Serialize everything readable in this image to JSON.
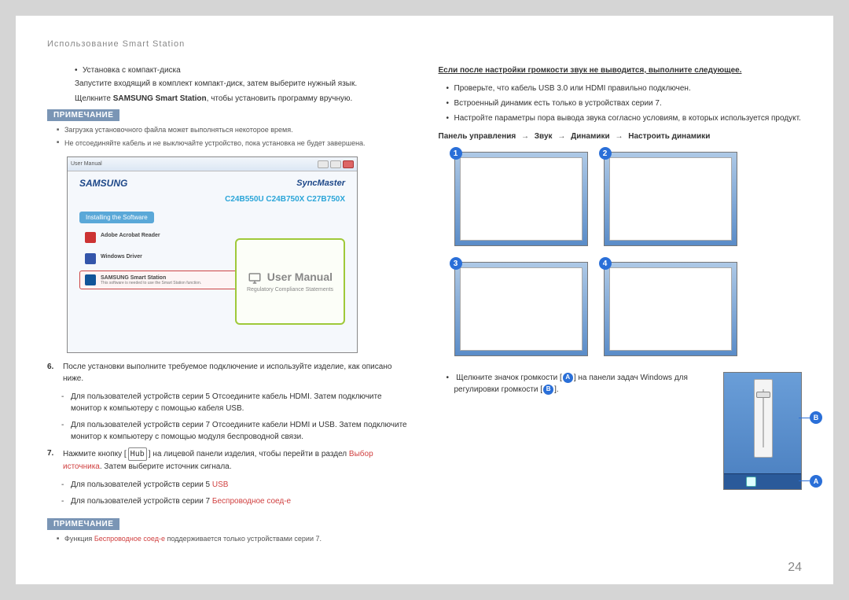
{
  "header": "Использование Smart Station",
  "page_number": "24",
  "left": {
    "install_cd": "Установка с компакт-диска",
    "install_cd_text": "Запустите входящий в комплект компакт-диск, затем выберите нужный язык.",
    "click_line_pre": "Щелкните ",
    "click_bold": "SAMSUNG Smart Station",
    "click_line_post": ", чтобы установить программу вручную.",
    "note_label": "ПРИМЕЧАНИЕ",
    "note1": "Загрузка установочного файла может выполняться некоторое время.",
    "note2": "Не отсоединяйте кабель и не выключайте устройство, пока установка не будет завершена.",
    "screenshot": {
      "titlebar": "User Manual",
      "samsung": "SAMSUNG",
      "syncmaster": "SyncMaster",
      "models": "C24B550U C24B750X C27B750X",
      "installing_bar": "Installing the Software",
      "item1_title": "Adobe Acrobat Reader",
      "item2_title": "Windows Driver",
      "item3_title": "SAMSUNG Smart Station",
      "item3_sub": "This software is needed to use the Smart Station function.",
      "um_text": "User Manual",
      "um_sub": "Regulatory Compliance Statements"
    },
    "step6_num": "6.",
    "step6": "После установки выполните требуемое подключение и используйте изделие, как описано ниже.",
    "step6_a": "Для пользователей устройств серии 5 Отсоедините кабель HDMI. Затем подключите монитор к компьютеру с помощью кабеля USB.",
    "step6_b": "Для пользователей устройств серии 7 Отсоедините кабели HDMI и USB. Затем подключите монитор к компьютеру с помощью модуля беспроводной связи.",
    "step7_num": "7.",
    "step7_pre": "Нажмите кнопку [",
    "step7_hub": "Hub",
    "step7_mid": "] на лицевой панели изделия, чтобы перейти в раздел ",
    "step7_red1": "Выбор источника",
    "step7_post": ". Затем выберите источник сигнала.",
    "step7_a_pre": "Для пользователей устройств серии 5 ",
    "step7_a_red": "USB",
    "step7_b_pre": "Для пользователей устройств серии 7 ",
    "step7_b_red": "Беспроводное соед-е",
    "note2_label": "ПРИМЕЧАНИЕ",
    "note2_items_pre": "Функция ",
    "note2_items_red": "Беспроводное соед-е",
    "note2_items_post": " поддерживается только устройствами серии 7."
  },
  "right": {
    "heading": "Если после настройки громкости звук не выводится, выполните следующее.",
    "b1": "Проверьте, что кабель USB 3.0 или HDMI правильно подключен.",
    "b2": "Встроенный динамик есть только в устройствах серии 7.",
    "b3": "Настройте параметры пора вывода звука согласно условиям, в которых используется продукт.",
    "path_cp": "Панель управления",
    "path_sound": "Звук",
    "path_speakers": "Динамики",
    "path_config": "Настроить динамики",
    "last_text_1": "Щелкните значок громкости [",
    "last_text_2": "] на панели задач Windows для регулировки громкости [",
    "last_text_3": "].",
    "letter_a": "A",
    "letter_b": "B"
  },
  "thumb_labels": {
    "n1": "1",
    "n2": "2",
    "n3": "3",
    "n4": "4"
  }
}
